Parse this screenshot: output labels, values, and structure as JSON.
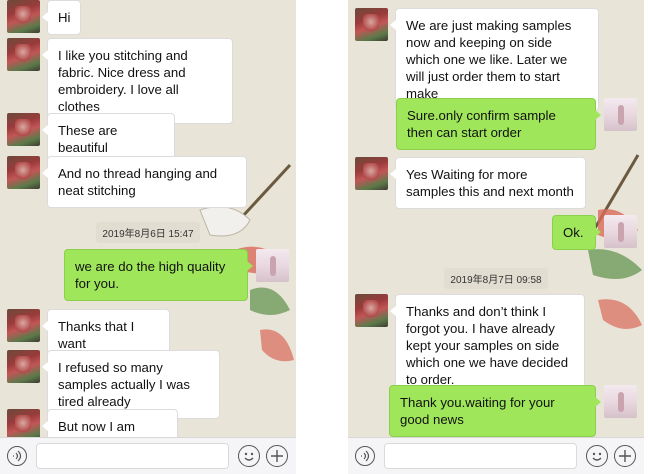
{
  "left_panel": {
    "messages": [
      {
        "side": "in",
        "text": "Hi"
      },
      {
        "side": "in",
        "text": "I like you stitching and fabric. Nice dress and embroidery. I love all clothes"
      },
      {
        "side": "in",
        "text": "These are beautiful"
      },
      {
        "side": "in",
        "text": "And no thread hanging and neat stitching"
      },
      {
        "side": "time",
        "text": "2019年8月6日 15:47"
      },
      {
        "side": "out",
        "text": "we are do the high quality for you."
      },
      {
        "side": "in",
        "text": "Thanks that I want"
      },
      {
        "side": "in",
        "text": "I refused so many samples actually I was tired already"
      },
      {
        "side": "in",
        "text": "But now I am happy"
      }
    ]
  },
  "right_panel": {
    "messages": [
      {
        "side": "in",
        "text": "We are just making samples now  and keeping on side which one we like. Later we will just order them to start make"
      },
      {
        "side": "out",
        "text": "Sure.only confirm sample then can start order"
      },
      {
        "side": "in",
        "text": "Yes Waiting for more samples this and next month"
      },
      {
        "side": "out",
        "text": "Ok."
      },
      {
        "side": "time",
        "text": "2019年8月7日 09:58"
      },
      {
        "side": "in",
        "text": "Thanks and don’t think I forgot you. I have already kept your samples on side which one we have decided to order."
      },
      {
        "side": "out",
        "text": "Thank you.waiting for your good news"
      }
    ]
  },
  "toolbar": {
    "icons": [
      "voice-icon",
      "emoji-icon",
      "plus-icon"
    ]
  },
  "colors": {
    "outgoing_bubble": "#9fe65a",
    "incoming_bubble": "#ffffff",
    "chat_background": "#e9e4d8",
    "toolbar_background": "#f5f5f7"
  }
}
